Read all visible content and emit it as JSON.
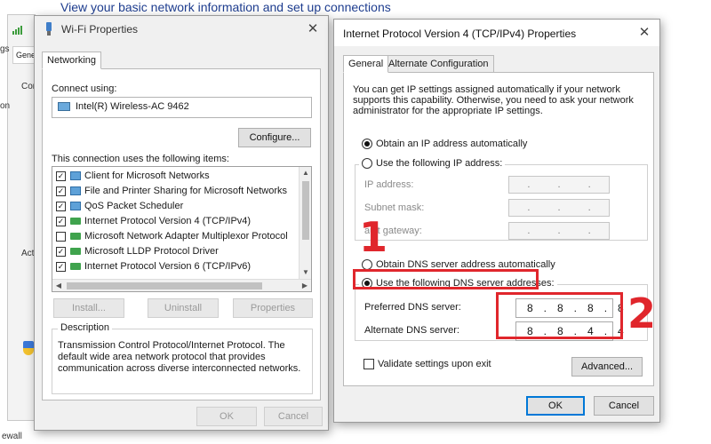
{
  "background": {
    "heading": "View your basic network information and set up connections",
    "tab_fragment": "Gene",
    "fragments": [
      "gs",
      "Con",
      "on",
      "Act",
      "ewall"
    ]
  },
  "wifi_properties": {
    "title": "Wi-Fi Properties",
    "tab": "Networking",
    "connect_using_label": "Connect using:",
    "adapter": "Intel(R) Wireless-AC 9462",
    "configure_button": "Configure...",
    "items_label": "This connection uses the following items:",
    "items": [
      {
        "label": "Client for Microsoft Networks",
        "checked": true,
        "icon": "network-client-icon"
      },
      {
        "label": "File and Printer Sharing for Microsoft Networks",
        "checked": true,
        "icon": "file-sharing-icon"
      },
      {
        "label": "QoS Packet Scheduler",
        "checked": true,
        "icon": "qos-icon"
      },
      {
        "label": "Internet Protocol Version 4 (TCP/IPv4)",
        "checked": true,
        "icon": "protocol-icon"
      },
      {
        "label": "Microsoft Network Adapter Multiplexor Protocol",
        "checked": false,
        "icon": "protocol-icon"
      },
      {
        "label": "Microsoft LLDP Protocol Driver",
        "checked": true,
        "icon": "protocol-icon"
      },
      {
        "label": "Internet Protocol Version 6 (TCP/IPv6)",
        "checked": true,
        "icon": "protocol-icon"
      }
    ],
    "install_button": "Install...",
    "uninstall_button": "Uninstall",
    "properties_button": "Properties",
    "description_legend": "Description",
    "description_text": "Transmission Control Protocol/Internet Protocol. The default wide area network protocol that provides communication across diverse interconnected networks.",
    "ok_button": "OK",
    "cancel_button": "Cancel"
  },
  "ipv4_properties": {
    "title": "Internet Protocol Version 4 (TCP/IPv4) Properties",
    "tabs": [
      "General",
      "Alternate Configuration"
    ],
    "info_text": "You can get IP settings assigned automatically if your network supports this capability. Otherwise, you need to ask your network administrator for the appropriate IP settings.",
    "radio_auto_ip": "Obtain an IP address automatically",
    "radio_manual_ip": "Use the following IP address:",
    "ip_address_label": "IP address:",
    "subnet_mask_label": "Subnet mask:",
    "default_gateway_label": "ault gateway:",
    "empty_ip": ". . .",
    "radio_auto_dns": "Obtain DNS server address automatically",
    "radio_manual_dns": "Use the following DNS server addresses:",
    "preferred_dns_label": "Preferred DNS server:",
    "preferred_dns_value": "8.8.8.8",
    "alternate_dns_label": "Alternate DNS server:",
    "alternate_dns_value": "8.8.4.4",
    "validate_label": "Validate settings upon exit",
    "advanced_button": "Advanced...",
    "ok_button": "OK",
    "cancel_button": "Cancel"
  },
  "annotations": {
    "step1": "1",
    "step2": "2",
    "color": "#e0262c"
  }
}
